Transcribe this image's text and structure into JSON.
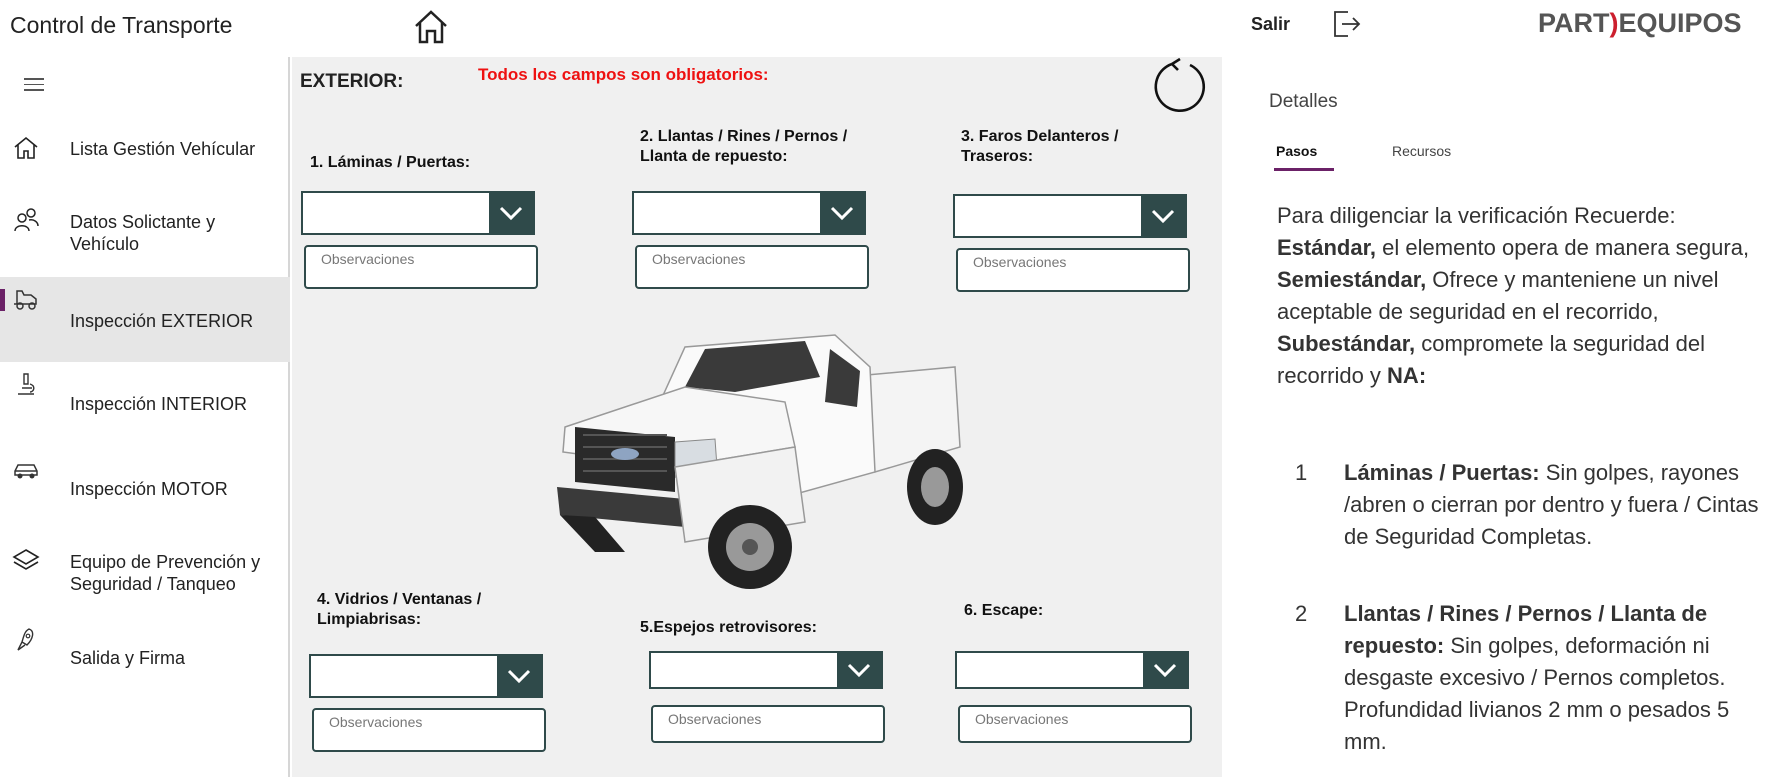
{
  "header": {
    "app_title": "Control de Transporte",
    "exit_label": "Salir",
    "logo_left": "PART",
    "logo_right": "EQUIPOS"
  },
  "sidebar": {
    "items": [
      {
        "label": "Lista  Gestión Vehícular",
        "icon": "home-icon"
      },
      {
        "label": "Datos Solictante y Vehículo",
        "icon": "users-icon"
      },
      {
        "label": "Inspección EXTERIOR",
        "icon": "truck-icon",
        "active": true
      },
      {
        "label": "Inspección INTERIOR",
        "icon": "microscope-icon"
      },
      {
        "label": "Inspección MOTOR",
        "icon": "car-icon"
      },
      {
        "label": "Equipo de Prevención y Seguridad / Tanqueo",
        "icon": "layers-icon"
      },
      {
        "label": "Salida y Firma",
        "icon": "rocket-icon"
      }
    ]
  },
  "form": {
    "section_title": "EXTERIOR:",
    "required_note": "Todos los campos son obligatorios:",
    "observations_placeholder": "Observaciones",
    "fields": [
      {
        "label": "1. Láminas / Puertas:"
      },
      {
        "label": "2. Llantas / Rines / Pernos / Llanta de repuesto:"
      },
      {
        "label": "3. Faros Delanteros / Traseros:"
      },
      {
        "label": "4. Vidrios / Ventanas / Limpiabrisas:"
      },
      {
        "label": "5.Espejos retrovisores:"
      },
      {
        "label": "6. Escape:"
      }
    ]
  },
  "panel": {
    "title": "Detalles",
    "tabs": [
      "Pasos",
      "Recursos"
    ],
    "intro_1": "Para diligenciar la verificación Recuerde:",
    "std": "Estándar,",
    "std_text": " el elemento opera de manera segura, ",
    "semi": "Semiestándar,",
    "semi_text": " Ofrece y manteniene un nivel aceptable de seguridad en el recorrido, ",
    "sub": "Subestándar,",
    "sub_text": " compromete la seguridad del recorrido y ",
    "na": "NA:",
    "steps": [
      {
        "num": "1",
        "title": "Láminas / Puertas:",
        "text": " Sin golpes, rayones /abren o cierran por dentro y fuera / Cintas de Seguridad Completas."
      },
      {
        "num": "2",
        "title": "Llantas / Rines / Pernos / Llanta de repuesto:",
        "text": " Sin golpes, deformación ni desgaste excesivo / Pernos completos. Profundidad livianos 2 mm o pesados 5 mm."
      }
    ]
  },
  "colors": {
    "accent": "#6b2167",
    "dropdown": "#2f4a4a",
    "required": "#ee1111",
    "logo_mark": "#cc1f2e"
  }
}
